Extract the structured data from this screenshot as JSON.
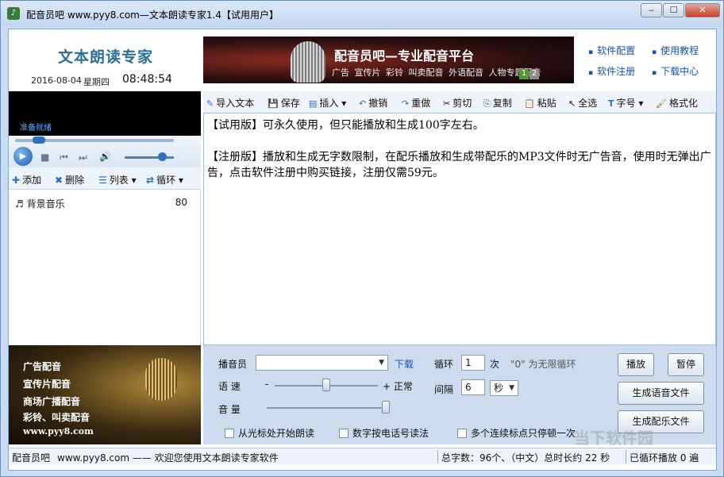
{
  "window": {
    "title": "配音员吧 www.pyy8.com—文本朗读专家1.4【试用用户】",
    "minimize": "‒",
    "maximize": "☐",
    "close": "✕"
  },
  "brand": {
    "title": "文本朗读专家",
    "date": "2016-08-04",
    "weekday": "星期四",
    "time": "08:48:54"
  },
  "banner": {
    "headline": "配音员吧—专业配音平台",
    "subline": "广告 宣传片 彩铃 叫卖配音 外语配音 人物专题配音",
    "pages": [
      "1",
      "2"
    ]
  },
  "toplinks": [
    "软件配置",
    "使用教程",
    "软件注册",
    "下载中心"
  ],
  "player": {
    "status": "准备就绪"
  },
  "listbar": {
    "add": "添加",
    "delete": "删除",
    "list": "列表",
    "loop": "循环"
  },
  "playlist": [
    {
      "name": "背景音乐",
      "value": "80"
    }
  ],
  "ad": {
    "lines": [
      "广告配音",
      "宣传片配音",
      "商场广播配音",
      "彩铃、叫卖配音"
    ],
    "url": "www.pyy8.com"
  },
  "toolbar": {
    "import": "导入文本",
    "save": "保存",
    "insert": "插入",
    "undo": "撤销",
    "redo": "重做",
    "cut": "剪切",
    "copy": "复制",
    "paste": "粘贴",
    "select_all": "全选",
    "font": "字号",
    "format": "格式化"
  },
  "editor": {
    "p1": "【试用版】可永久使用，但只能播放和生成100字左右。",
    "p2": "【注册版】播放和生成无字数限制，在配乐播放和生成带配乐的MP3文件时无广告音，使用时无弹出广告，点击软件注册中购买链接，注册仅需59元。"
  },
  "settings": {
    "announcer_label": "播音员",
    "announcer_value": "",
    "download": "下载",
    "loop_label": "循环",
    "loop_value": "1",
    "loop_unit": "次",
    "loop_hint": "\"0\" 为无限循环",
    "speed_label": "语 速",
    "speed_minus": "-",
    "speed_plus": "+ 正常",
    "speed_level": 0.5,
    "interval_label": "间隔",
    "interval_value": "6",
    "interval_unit": "秒",
    "volume_label": "音 量",
    "volume_level": 1.0,
    "chk_cursor": "从光标处开始朗读",
    "chk_phone": "数字按电话号读法",
    "chk_pause": "多个连续标点只停顿一次",
    "play_btn": "播放",
    "pause_btn": "暂停",
    "gen_voice_btn": "生成语音文件",
    "gen_music_btn": "生成配乐文件"
  },
  "statusbar": {
    "site": "配音员吧",
    "welcome": "www.pyy8.com —— 欢迎您使用文本朗读专家软件",
    "stats": "总字数：96个、（中文）总时长约 22 秒",
    "loop_count": "已循环播放 0 遍"
  },
  "watermark": "当下软件园"
}
